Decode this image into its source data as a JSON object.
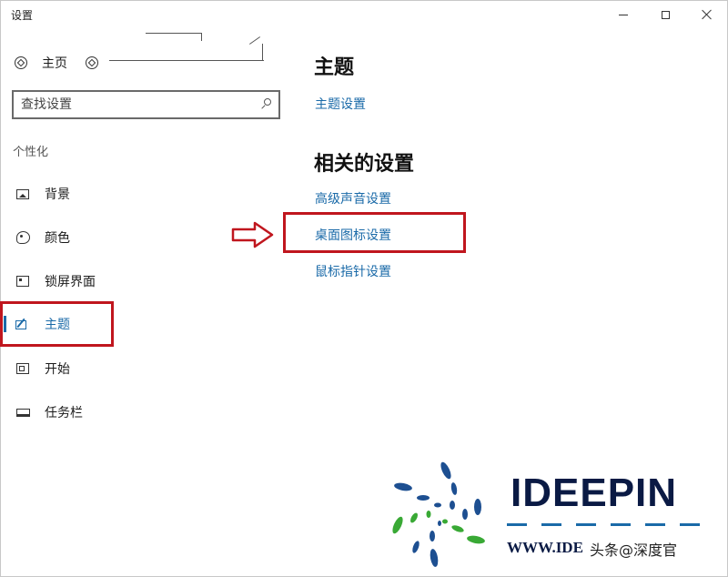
{
  "window": {
    "title": "设置",
    "controls": {
      "minimize": "minimize-icon",
      "maximize": "maximize-icon",
      "close": "close-icon"
    }
  },
  "sidebar": {
    "home_label": "主页",
    "search_placeholder": "查找设置",
    "section_label": "个性化",
    "items": [
      {
        "label": "背景",
        "icon": "image-icon",
        "selected": false
      },
      {
        "label": "颜色",
        "icon": "palette-icon",
        "selected": false
      },
      {
        "label": "锁屏界面",
        "icon": "lock-screen-icon",
        "selected": false
      },
      {
        "label": "主题",
        "icon": "brush-icon",
        "selected": true
      },
      {
        "label": "开始",
        "icon": "start-icon",
        "selected": false
      },
      {
        "label": "任务栏",
        "icon": "taskbar-icon",
        "selected": false
      }
    ]
  },
  "main": {
    "title": "主题",
    "theme_settings_link": "主题设置",
    "related_title": "相关的设置",
    "related_links": [
      "高级声音设置",
      "桌面图标设置",
      "鼠标指针设置"
    ]
  },
  "annotations": {
    "highlight_color": "#c0161e",
    "accent_color": "#1a6aa8"
  },
  "watermark": {
    "brand": "IDEEPIN",
    "url": "WWW.IDE",
    "caption": "头条@深度官"
  }
}
